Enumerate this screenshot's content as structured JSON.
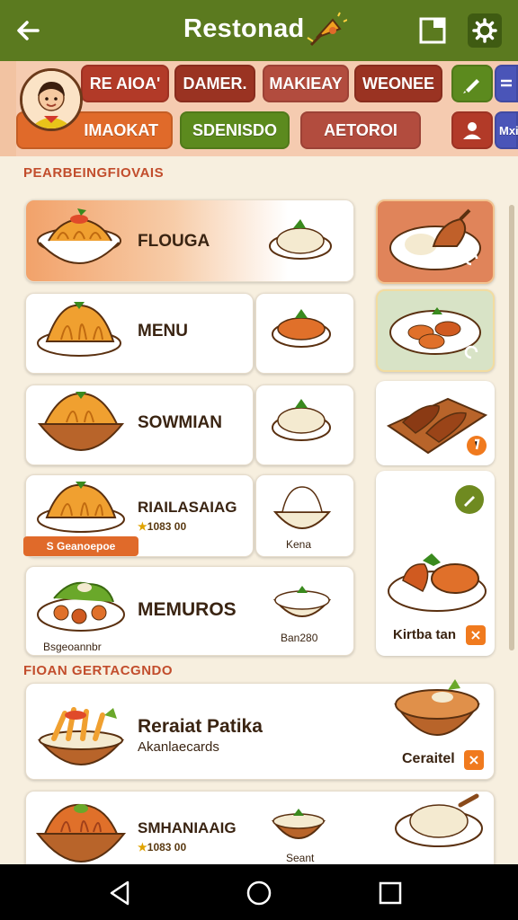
{
  "app": {
    "title": "Restonad"
  },
  "chips_row1": [
    "RE AIOA'",
    "DAMER.",
    "MAKIEAY",
    "WEONEE"
  ],
  "chips_row2": [
    "IMAOKAT",
    "SDENISDO",
    "AETOROI",
    "Mxi"
  ],
  "colors": {
    "appbar": "#5b7a1f",
    "accent_orange": "#e06a2a",
    "chip_red": "#b23a28",
    "chip_dark": "#9a3322",
    "chip_green": "#5c8a1e",
    "chip_clay": "#b24c3e",
    "chip_blue": "#4a55b8",
    "section_header": "#c24d2c"
  },
  "sections": {
    "first_header": "PEARBEINGFIOVAIS",
    "second_header": "FIOAN GERTACGNDO"
  },
  "list": [
    {
      "title": "FLOUGA"
    },
    {
      "title": "MENU"
    },
    {
      "title": "SOWMIAN"
    },
    {
      "title": "RIAILASAIAG",
      "rating": "1083 00",
      "tag": "S Geanoepoe",
      "price": "Kena"
    },
    {
      "title": "MEMUROS",
      "subtitle": "Bsgeoannbr",
      "price": "Ban280"
    }
  ],
  "side_items": [
    {
      "label": "Kirtba tan"
    }
  ],
  "feature_list": [
    {
      "title": "Reraiat Patika",
      "subtitle": "Akanlaecards",
      "label": "Ceraitel"
    },
    {
      "title": "SMHANIAAIG",
      "rating": "1083 00",
      "price": "Seant"
    }
  ],
  "icons": [
    "back-arrow-icon",
    "window-icon",
    "gear-icon",
    "edit-icon",
    "refresh-icon",
    "close-icon",
    "pencil-icon",
    "home-icon",
    "recents-icon"
  ]
}
